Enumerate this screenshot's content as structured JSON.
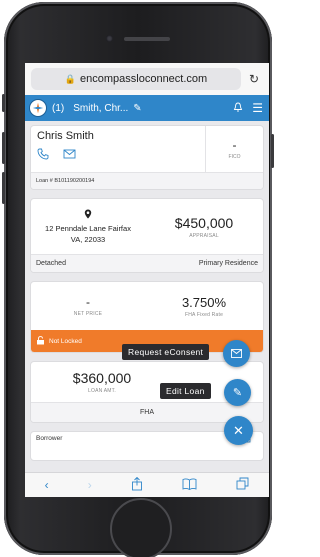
{
  "browser": {
    "url": "encompassloconnect.com",
    "lock_icon": "lock-icon",
    "reload_icon": "reload-icon"
  },
  "appbar": {
    "count": "(1)",
    "borrower_name": "Smith, Chr...",
    "accent": "#2f86c9"
  },
  "borrower_card": {
    "name": "Chris Smith",
    "fico_value": "-",
    "fico_label": "FICO",
    "loan_number": "Loan # B101190200194"
  },
  "property_card": {
    "address_line1": "12 Penndale Lane Fairfax",
    "address_line2": "VA, 22033",
    "appraisal_value": "$450,000",
    "appraisal_label": "APPRAISAL",
    "property_type": "Detached",
    "occupancy": "Primary Residence"
  },
  "pricing_card": {
    "net_price_value": "-",
    "net_price_label": "NET PRICE",
    "rate_value": "3.750%",
    "rate_label": "FHA Fixed Rate",
    "lock_status": "Not Locked",
    "status_color": "#f07b2a"
  },
  "loan_card": {
    "loan_amount": "$360,000",
    "loan_amount_label": "LOAN AMT.",
    "loan_type": "FHA"
  },
  "borrower_section": {
    "label": "Borrower"
  },
  "actions": {
    "request_econsent": "Request eConsent",
    "edit_loan": "Edit Loan"
  }
}
